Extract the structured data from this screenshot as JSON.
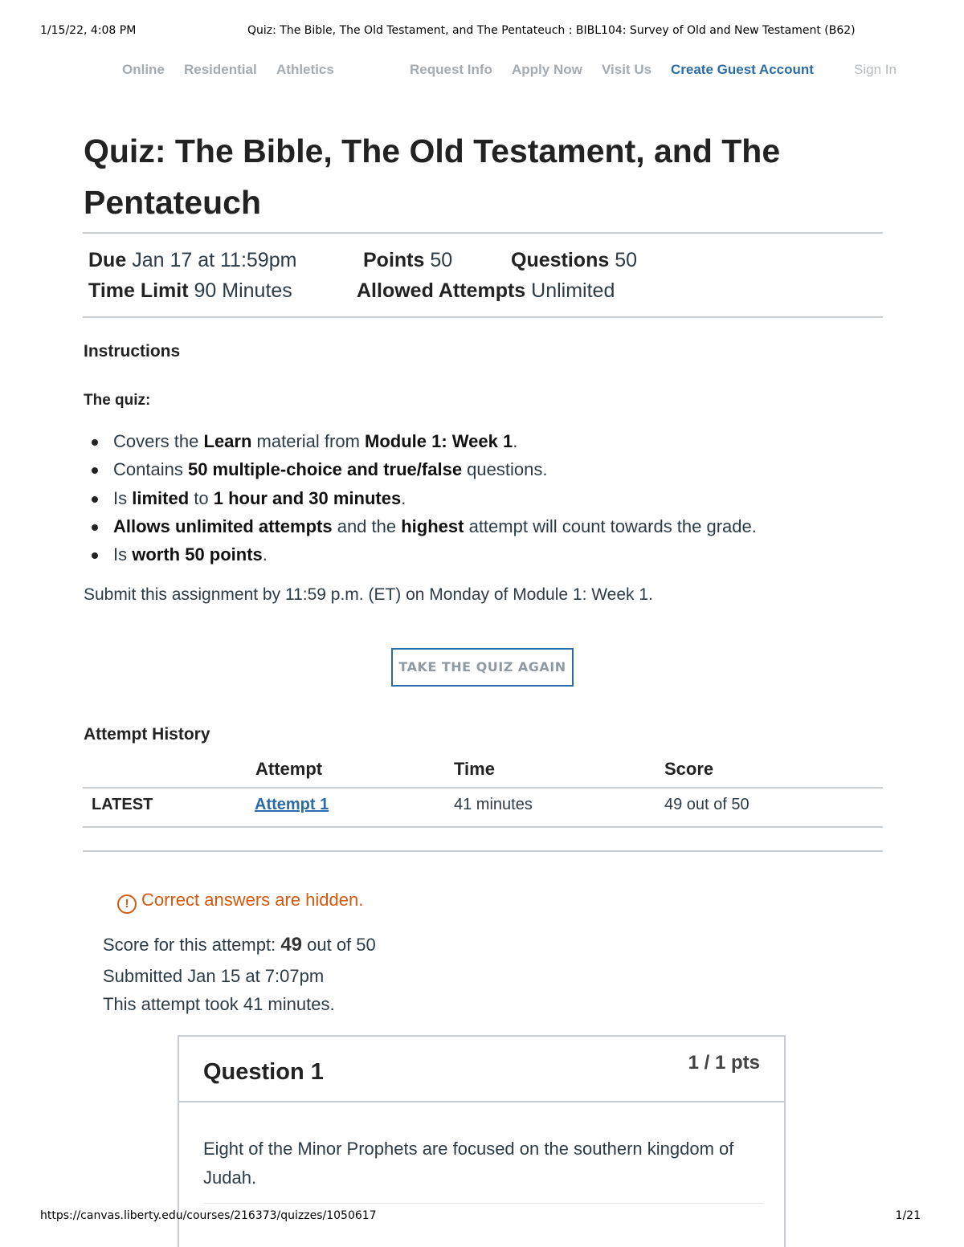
{
  "print_header": {
    "datetime": "1/15/22, 4:08 PM",
    "doc_title": "Quiz: The Bible, The Old Testament, and The Pentateuch : BIBL104: Survey of Old and New Testament (B62)"
  },
  "nav": {
    "online": "Online",
    "residential": "Residential",
    "athletics": "Athletics",
    "request_info": "Request Info",
    "apply_now": "Apply Now",
    "visit_us": "Visit Us",
    "create_guest": "Create Guest Account",
    "sign_in": "Sign In"
  },
  "quiz": {
    "title": "Quiz: The Bible, The Old Testament, and The Pentateuch",
    "due_label": "Due",
    "due_value": "Jan 17 at 11:59pm",
    "points_label": "Points",
    "points_value": "50",
    "questions_label": "Questions",
    "questions_value": "50",
    "time_limit_label": "Time Limit",
    "time_limit_value": "90 Minutes",
    "attempts_label": "Allowed Attempts",
    "attempts_value": "Unlimited"
  },
  "instructions": {
    "heading": "Instructions",
    "intro": "The quiz:",
    "bullets": [
      [
        {
          "t": "Covers the ",
          "b": false
        },
        {
          "t": "Learn",
          "b": true
        },
        {
          "t": " material from ",
          "b": false
        },
        {
          "t": "Module 1: Week 1",
          "b": true
        },
        {
          "t": ".",
          "b": false
        }
      ],
      [
        {
          "t": "Contains ",
          "b": false
        },
        {
          "t": "50 multiple-choice and true/false",
          "b": true
        },
        {
          "t": " questions.",
          "b": false
        }
      ],
      [
        {
          "t": "Is ",
          "b": false
        },
        {
          "t": "limited",
          "b": true
        },
        {
          "t": " to ",
          "b": false
        },
        {
          "t": "1 hour and 30 minutes",
          "b": true
        },
        {
          "t": ".",
          "b": false
        }
      ],
      [
        {
          "t": "Allows unlimited attempts",
          "b": true
        },
        {
          "t": " and the ",
          "b": false
        },
        {
          "t": "highest",
          "b": true
        },
        {
          "t": " attempt will count towards the grade.",
          "b": false
        }
      ],
      [
        {
          "t": "Is ",
          "b": false
        },
        {
          "t": "worth 50 points",
          "b": true
        },
        {
          "t": ".",
          "b": false
        }
      ]
    ],
    "submit_note": "Submit this assignment by 11:59 p.m. (ET) on Monday of Module 1: Week 1."
  },
  "take_quiz_button": "TAKE THE QUIZ AGAIN",
  "attempt_history": {
    "heading": "Attempt History",
    "columns": [
      "Attempt",
      "Time",
      "Score"
    ],
    "rows": [
      {
        "tag": "LATEST",
        "attempt": "Attempt 1",
        "time": "41 minutes",
        "score": "49 out of 50"
      }
    ]
  },
  "result": {
    "warning": "Correct answers are hidden.",
    "score_prefix": "Score for this attempt: ",
    "score": "49",
    "score_suffix": " out of 50",
    "submitted": "Submitted Jan 15 at 7:07pm",
    "duration": "This attempt took 41 minutes."
  },
  "question": {
    "title": "Question 1",
    "points": "1 / 1 pts",
    "text": "Eight of the Minor Prophets are focused on the southern kingdom of Judah."
  },
  "print_footer": {
    "url": "https://canvas.liberty.edu/courses/216373/quizzes/1050617",
    "page": "1/21"
  },
  "colors": {
    "link_blue": "#2a6ca8",
    "warning_orange": "#d55a10",
    "nav_gray": "#a4abb1"
  }
}
